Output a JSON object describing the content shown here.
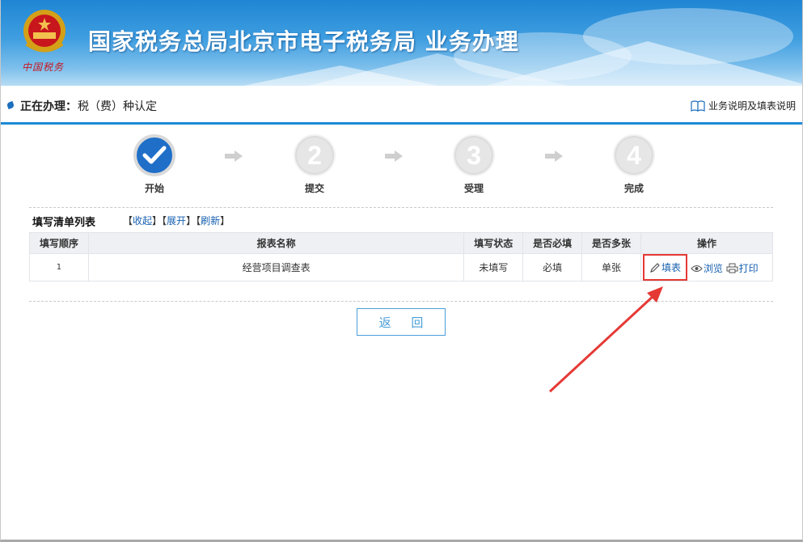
{
  "header": {
    "title": "国家税务总局北京市电子税务局  业务办理",
    "emblem_text": "中国税务"
  },
  "task": {
    "label": "正在办理：",
    "value": "税（费）种认定",
    "help_link": "业务说明及填表说明",
    "help_icon": "book-icon"
  },
  "steps": [
    {
      "number": "",
      "label": "开始",
      "state": "done"
    },
    {
      "number": "2",
      "label": "提交",
      "state": "pending"
    },
    {
      "number": "3",
      "label": "受理",
      "state": "pending"
    },
    {
      "number": "4",
      "label": "完成",
      "state": "pending"
    }
  ],
  "list": {
    "title": "填写清单列表",
    "collapse": "收起",
    "expand": "展开",
    "refresh": "刷新",
    "columns": [
      "填写顺序",
      "报表名称",
      "填写状态",
      "是否必填",
      "是否多张",
      "操作"
    ],
    "rows": [
      {
        "order": "1",
        "name": "经营项目调查表",
        "status": "未填写",
        "required": "必填",
        "multi": "单张",
        "actions": {
          "fill": "填表",
          "preview": "浏览",
          "print": "打印"
        }
      }
    ]
  },
  "back_button": "返 回",
  "colors": {
    "accent": "#1d8ad6",
    "link": "#1660b0",
    "annotation": "#e53935"
  }
}
